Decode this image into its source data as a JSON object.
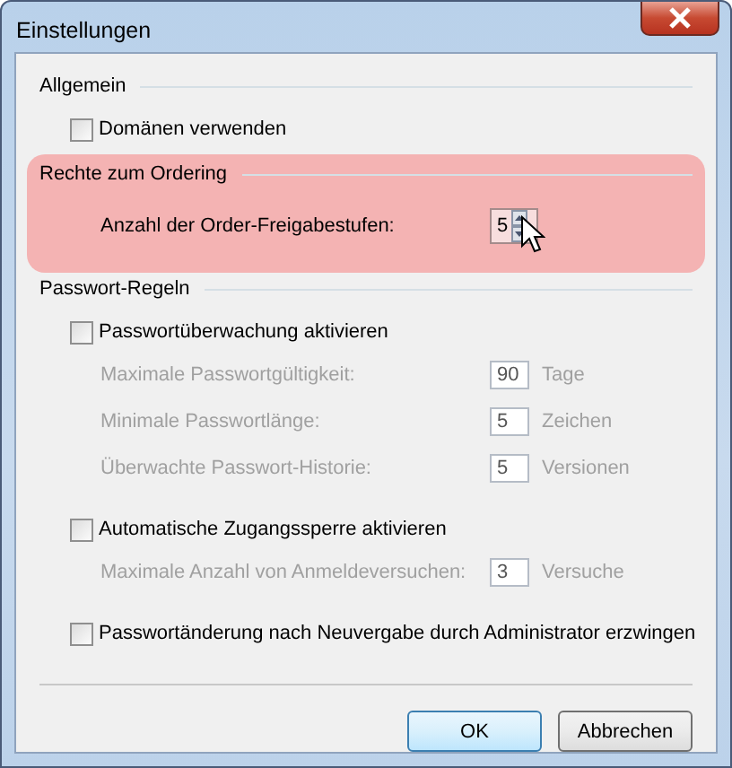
{
  "window": {
    "title": "Einstellungen"
  },
  "sections": [
    {
      "heading": "Allgemein",
      "highlighted": false,
      "items": [
        {
          "kind": "checkbox",
          "label": "Domänen verwenden",
          "checked": false
        }
      ]
    },
    {
      "heading": "Rechte zum Ordering",
      "highlighted": true,
      "items": [
        {
          "kind": "spin",
          "label": "Anzahl der Order-Freigabestufen:",
          "value": "5"
        }
      ]
    },
    {
      "heading": "Passwort-Regeln",
      "highlighted": false,
      "items": [
        {
          "kind": "checkbox",
          "label": "Passwortüberwachung aktivieren",
          "checked": false
        },
        {
          "kind": "number",
          "label": "Maximale Passwortgültigkeit:",
          "value": "90",
          "unit": "Tage",
          "disabled": true
        },
        {
          "kind": "number",
          "label": "Minimale Passwortlänge:",
          "value": "5",
          "unit": "Zeichen",
          "disabled": true
        },
        {
          "kind": "number",
          "label": "Überwachte Passwort-Historie:",
          "value": "5",
          "unit": "Versionen",
          "disabled": true
        },
        {
          "kind": "checkbox",
          "label": "Automatische Zugangssperre aktivieren",
          "checked": false
        },
        {
          "kind": "number",
          "label": "Maximale Anzahl von Anmeldeversuchen:",
          "value": "3",
          "unit": "Versuche",
          "disabled": true
        },
        {
          "kind": "checkbox",
          "label": "Passwortänderung nach Neuvergabe durch Administrator erzwingen",
          "checked": false
        }
      ]
    }
  ],
  "buttons": [
    {
      "label": "OK",
      "default": true
    },
    {
      "label": "Abbrechen",
      "default": false
    }
  ]
}
